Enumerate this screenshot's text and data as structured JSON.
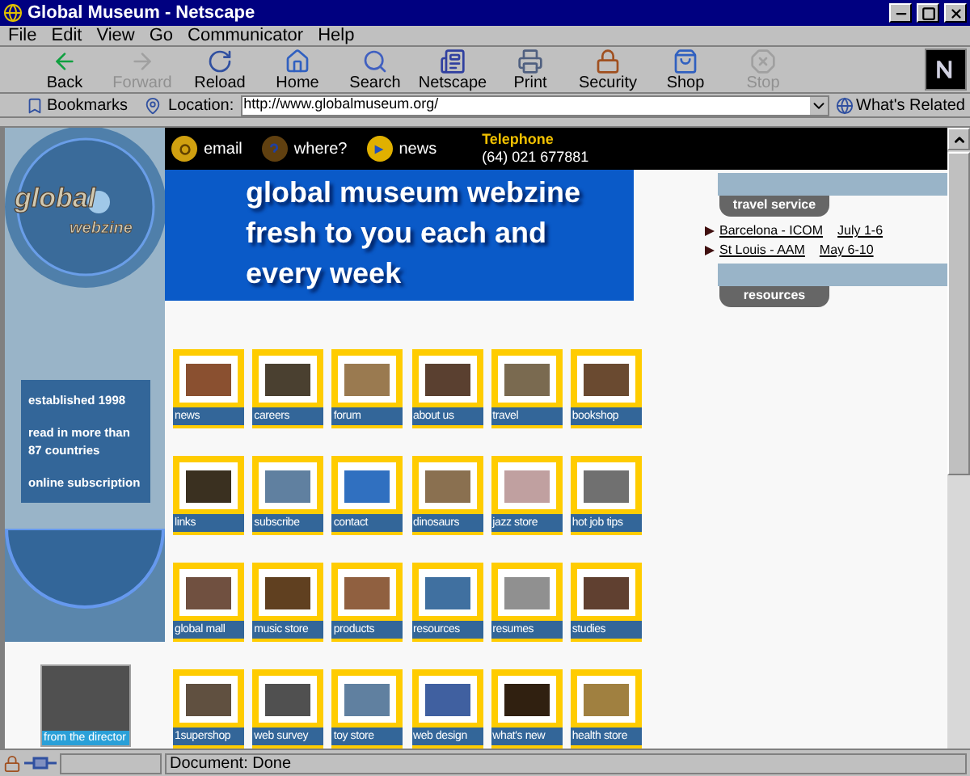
{
  "window": {
    "title": "Global Museum - Netscape"
  },
  "menu": [
    "File",
    "Edit",
    "View",
    "Go",
    "Communicator",
    "Help"
  ],
  "toolbar": [
    {
      "label": "Back",
      "disabled": false
    },
    {
      "label": "Forward",
      "disabled": true
    },
    {
      "label": "Reload",
      "disabled": false
    },
    {
      "label": "Home",
      "disabled": false
    },
    {
      "label": "Search",
      "disabled": false
    },
    {
      "label": "Netscape",
      "disabled": false
    },
    {
      "label": "Print",
      "disabled": false
    },
    {
      "label": "Security",
      "disabled": false
    },
    {
      "label": "Shop",
      "disabled": false
    },
    {
      "label": "Stop",
      "disabled": true
    }
  ],
  "location_bar": {
    "bookmarks": "Bookmarks",
    "label": "Location:",
    "url": "http://www.globalmuseum.org/",
    "related": "What's Related"
  },
  "page": {
    "logo": {
      "line_1": "global",
      "line_2": "webzine"
    },
    "top_links": [
      "email",
      "where?",
      "news"
    ],
    "telephone": {
      "label": "Telephone",
      "number": "(64) 021 677881"
    },
    "banner": "global museum webzine fresh to you each and every week",
    "info": [
      "established 1998",
      "read in more than 87 countries",
      "online subscription"
    ],
    "director": "from the director",
    "sections": [
      {
        "title": "travel service",
        "links": [
          {
            "name": "Barcelona - ICOM",
            "dates": "July 1-6"
          },
          {
            "name": "St Louis - AAM",
            "dates": "May 6-10"
          }
        ]
      },
      {
        "title": "resources"
      }
    ],
    "tiles": [
      "news",
      "careers",
      "forum",
      "about us",
      "travel",
      "bookshop",
      "links",
      "subscribe",
      "contact",
      "dinosaurs",
      "jazz store",
      "hot job tips",
      "global mall",
      "music store",
      "products",
      "resources",
      "resumes",
      "studies",
      "1supershop",
      "web survey",
      "toy store",
      "web design",
      "what's new",
      "health store"
    ]
  },
  "status_bar": {
    "text": "Document: Done"
  }
}
